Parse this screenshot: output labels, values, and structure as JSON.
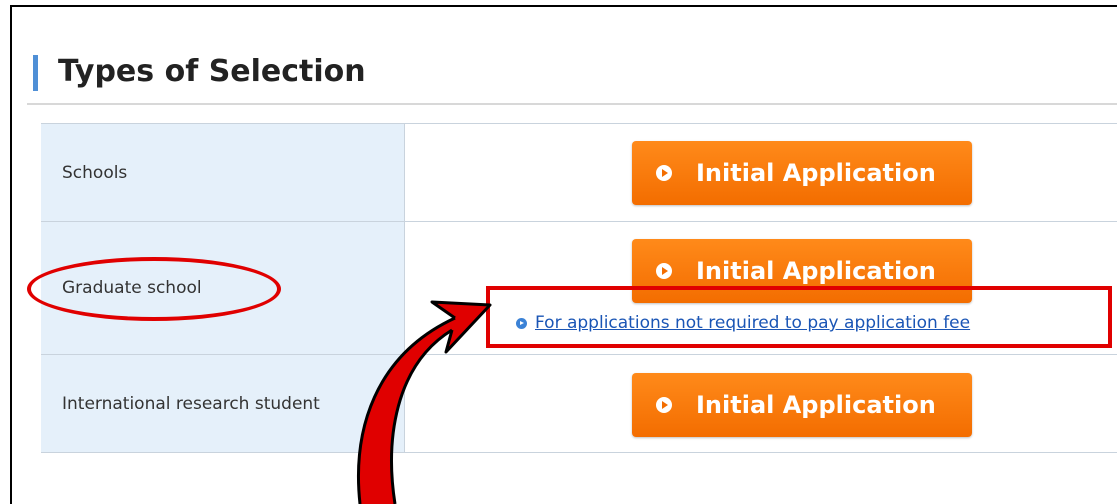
{
  "section": {
    "title": "Types of Selection"
  },
  "rows": [
    {
      "label": "Schools",
      "button_label": "Initial Application"
    },
    {
      "label": "Graduate school",
      "button_label": "Initial Application",
      "link_label": "For applications not required to pay application fee"
    },
    {
      "label": "International research student",
      "button_label": "Initial Application"
    }
  ],
  "colors": {
    "accent": "#4f8fd6",
    "button": "#f37a0a",
    "label_bg": "#e5f0fa",
    "link": "#1a55b5",
    "annotation": "#e00000"
  },
  "icons": {
    "button": "play-circle-icon",
    "link": "play-circle-small-icon"
  }
}
